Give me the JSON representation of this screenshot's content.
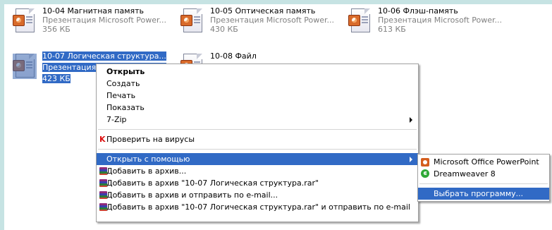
{
  "files": [
    {
      "name": "10-04 Магнитная память",
      "type": "Презентация Microsoft Power...",
      "size": "356 КБ"
    },
    {
      "name": "10-05 Оптическая память",
      "type": "Презентация Microsoft Power...",
      "size": "430 КБ"
    },
    {
      "name": "10-06 Флэш-память",
      "type": "Презентация Microsoft Power...",
      "size": "613 КБ"
    },
    {
      "name": "10-07 Логическая структура...",
      "type": "Презентация Microsoft Power...",
      "size": "423 КБ"
    },
    {
      "name": "10-08 Файл",
      "type": "",
      "size": ""
    }
  ],
  "context_menu": {
    "open": "Открыть",
    "create": "Создать",
    "print": "Печать",
    "show": "Показать",
    "zip": "7-Zip",
    "scan": "Проверить на вирусы",
    "open_with": "Открыть с помощью",
    "add_archive": "Добавить в архив...",
    "add_archive_named": "Добавить в архив \"10-07 Логическая структура.rar\"",
    "add_archive_email": "Добавить в архив и отправить по e-mail...",
    "add_archive_named_email": "Добавить в архив \"10-07 Логическая структура.rar\" и отправить по e-mail"
  },
  "submenu": {
    "powerpoint": "Microsoft Office PowerPoint",
    "dreamweaver": "Dreamweaver 8",
    "choose": "Выбрать программу..."
  },
  "icons": {
    "ppt": "powerpoint-file-icon",
    "rar": "winrar-archive-icon",
    "kav": "kaspersky-icon",
    "dw": "dreamweaver-icon"
  },
  "colors": {
    "selection": "#316ac5",
    "background": "#c6e3e3"
  }
}
